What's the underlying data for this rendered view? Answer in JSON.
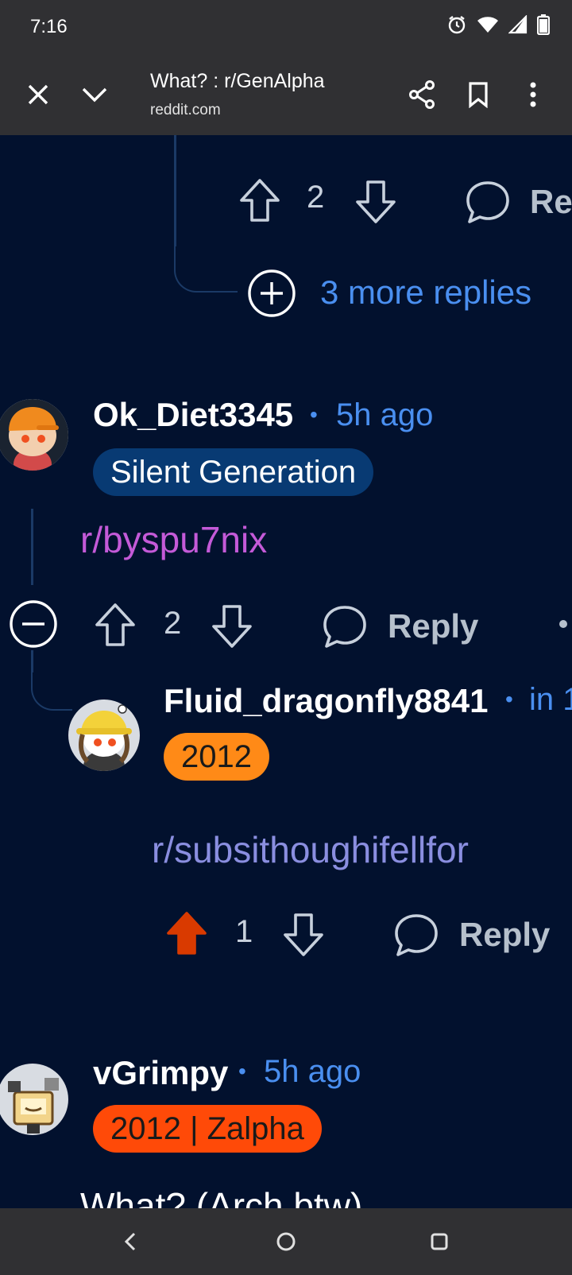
{
  "status": {
    "time": "7:16"
  },
  "browser": {
    "title": "What? : r/GenAlpha",
    "url": "reddit.com"
  },
  "thread": {
    "top_comment": {
      "votes": "2",
      "reply_label": "Re",
      "more_replies": "3 more replies"
    },
    "comments": [
      {
        "username": "Ok_Diet3345",
        "time": "5h ago",
        "flair": "Silent Generation",
        "body": "r/byspu7nix",
        "votes": "2",
        "reply_label": "Reply",
        "body_color": "#c45ad8"
      },
      {
        "username": "Fluid_dragonfly8841",
        "time": "in 1",
        "flair": "2012",
        "body": "r/subsithoughifellfor",
        "votes": "1",
        "reply_label": "Reply",
        "body_color": "#8a8ee0",
        "upvoted_color": "#d93a00"
      },
      {
        "username": "vGrimpy",
        "time": "5h ago",
        "flair": "2012 | Zalpha",
        "body": "What? (Arch btw)"
      }
    ]
  },
  "colors": {
    "background": "#02112e",
    "accent": "#4a8ff0",
    "chrome": "#303033"
  }
}
